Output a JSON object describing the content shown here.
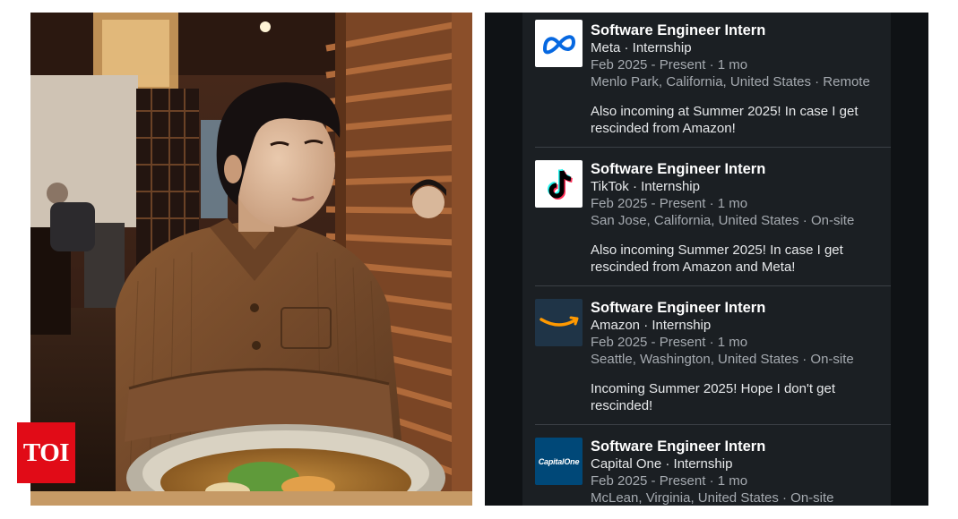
{
  "badge": {
    "label": "TOI"
  },
  "experience": [
    {
      "logo_icon": "meta-logo-icon",
      "title": "Software Engineer Intern",
      "company": "Meta · Internship",
      "dates": "Feb 2025 - Present · 1 mo",
      "location": "Menlo Park, California, United States · Remote",
      "description": "Also incoming at Summer 2025! In case I get rescinded from Amazon!"
    },
    {
      "logo_icon": "tiktok-logo-icon",
      "title": "Software Engineer Intern",
      "company": "TikTok · Internship",
      "dates": "Feb 2025 - Present · 1 mo",
      "location": "San Jose, California, United States · On-site",
      "description": "Also incoming Summer 2025! In case I get rescinded from Amazon and Meta!"
    },
    {
      "logo_icon": "amazon-logo-icon",
      "title": "Software Engineer Intern",
      "company": "Amazon · Internship",
      "dates": "Feb 2025 - Present · 1 mo",
      "location": "Seattle, Washington, United States · On-site",
      "description": "Incoming Summer 2025! Hope I don't get rescinded!"
    },
    {
      "logo_icon": "capital-one-logo-icon",
      "logo_text": "CapitalOne",
      "title": "Software Engineer Intern",
      "company": "Capital One · Internship",
      "dates": "Feb 2025 - Present · 1 mo",
      "location": "McLean, Virginia, United States · On-site"
    }
  ],
  "colors": {
    "panel_bg": "#1b1f23",
    "title_text": "#ffffff",
    "secondary_text": "#a5aab0",
    "toi_red": "#e10b17",
    "amazon_orange": "#ff9900",
    "meta_blue": "#0668e1"
  }
}
